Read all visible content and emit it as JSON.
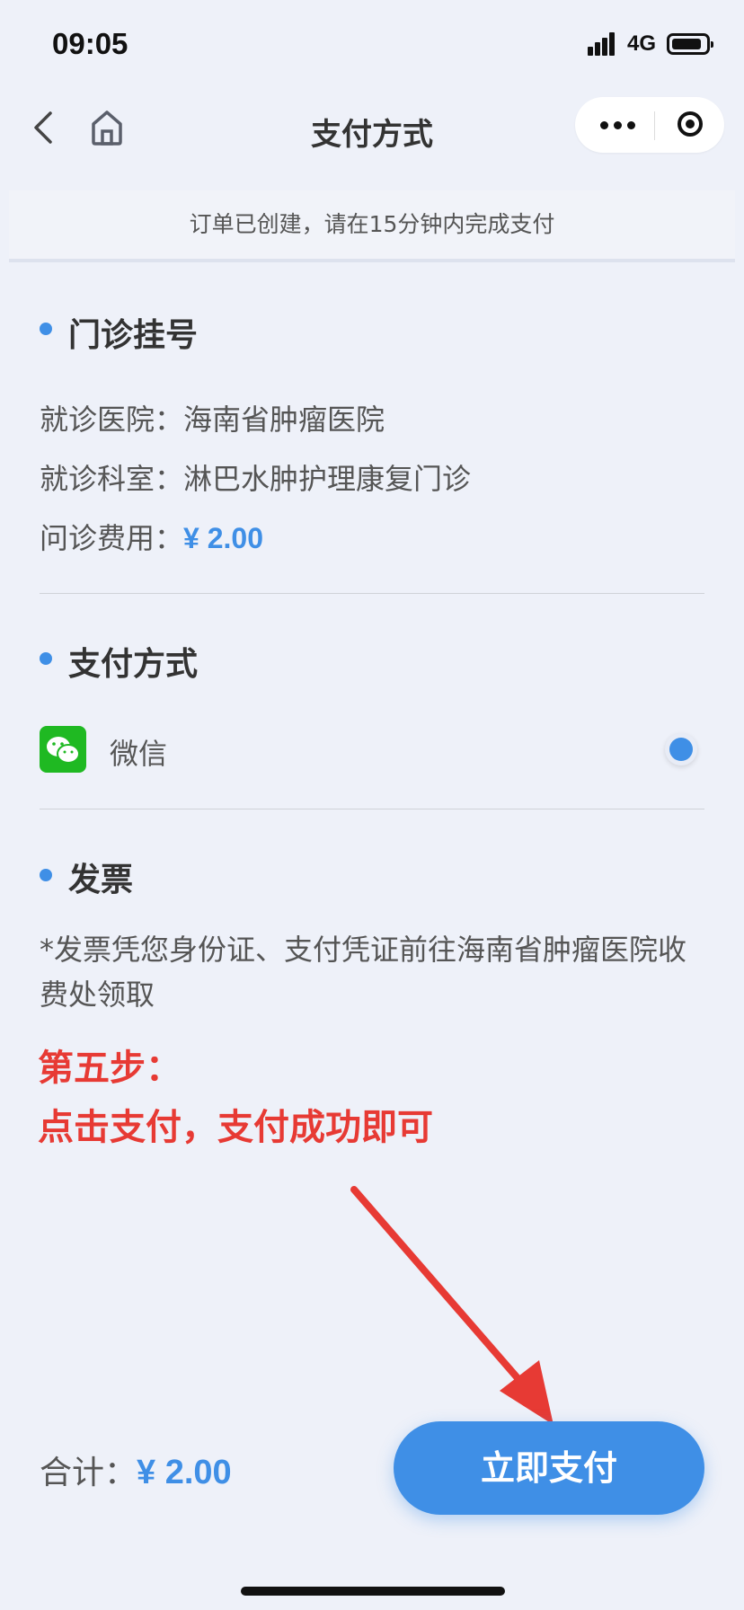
{
  "status_bar": {
    "time": "09:05",
    "network": "4G"
  },
  "nav": {
    "title": "支付方式"
  },
  "notice": "订单已创建，请在15分钟内完成支付",
  "registration": {
    "header": "门诊挂号",
    "hospital_label": "就诊医院：",
    "hospital_value": "海南省肿瘤医院",
    "department_label": "就诊科室：",
    "department_value": "淋巴水肿护理康复门诊",
    "fee_label": "问诊费用：",
    "fee_value": "¥ 2.00"
  },
  "payment": {
    "header": "支付方式",
    "method_label": "微信",
    "method_icon": "wechat-icon",
    "selected": true
  },
  "invoice": {
    "header": "发票",
    "text": "*发票凭您身份证、支付凭证前往海南省肿瘤医院收费处领取"
  },
  "annotation": {
    "step": "第五步：",
    "instruction": "点击支付，支付成功即可"
  },
  "footer": {
    "total_label": "合计：",
    "total_value": "¥ 2.00",
    "pay_button": "立即支付"
  },
  "colors": {
    "accent": "#3f8fe6",
    "annotation": "#e73a34",
    "wechat": "#1fb922",
    "background": "#eef1f9"
  }
}
